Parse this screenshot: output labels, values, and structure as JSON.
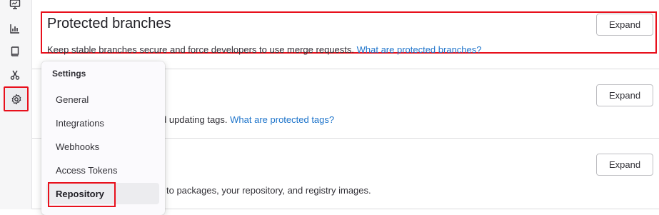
{
  "sidebar": {
    "icons": [
      "monitor-icon",
      "analytics-icon",
      "book-icon",
      "scissors-icon",
      "settings-icon"
    ]
  },
  "sections": [
    {
      "title": "Protected branches",
      "description": "Keep stable branches secure and force developers to use merge requests.",
      "link": "What are protected branches?",
      "button": "Expand"
    },
    {
      "description": "d updating tags.",
      "link": "What are protected tags?",
      "button": "Expand"
    },
    {
      "description": "to packages, your repository, and registry images.",
      "button": "Expand"
    }
  ],
  "flyout": {
    "header": "Settings",
    "items": [
      "General",
      "Integrations",
      "Webhooks",
      "Access Tokens",
      "Repository"
    ],
    "active_item": "Repository"
  },
  "colors": {
    "highlight": "#e8101c",
    "link": "#1f75cb",
    "sidebar_bg": "#f6f6f7"
  }
}
